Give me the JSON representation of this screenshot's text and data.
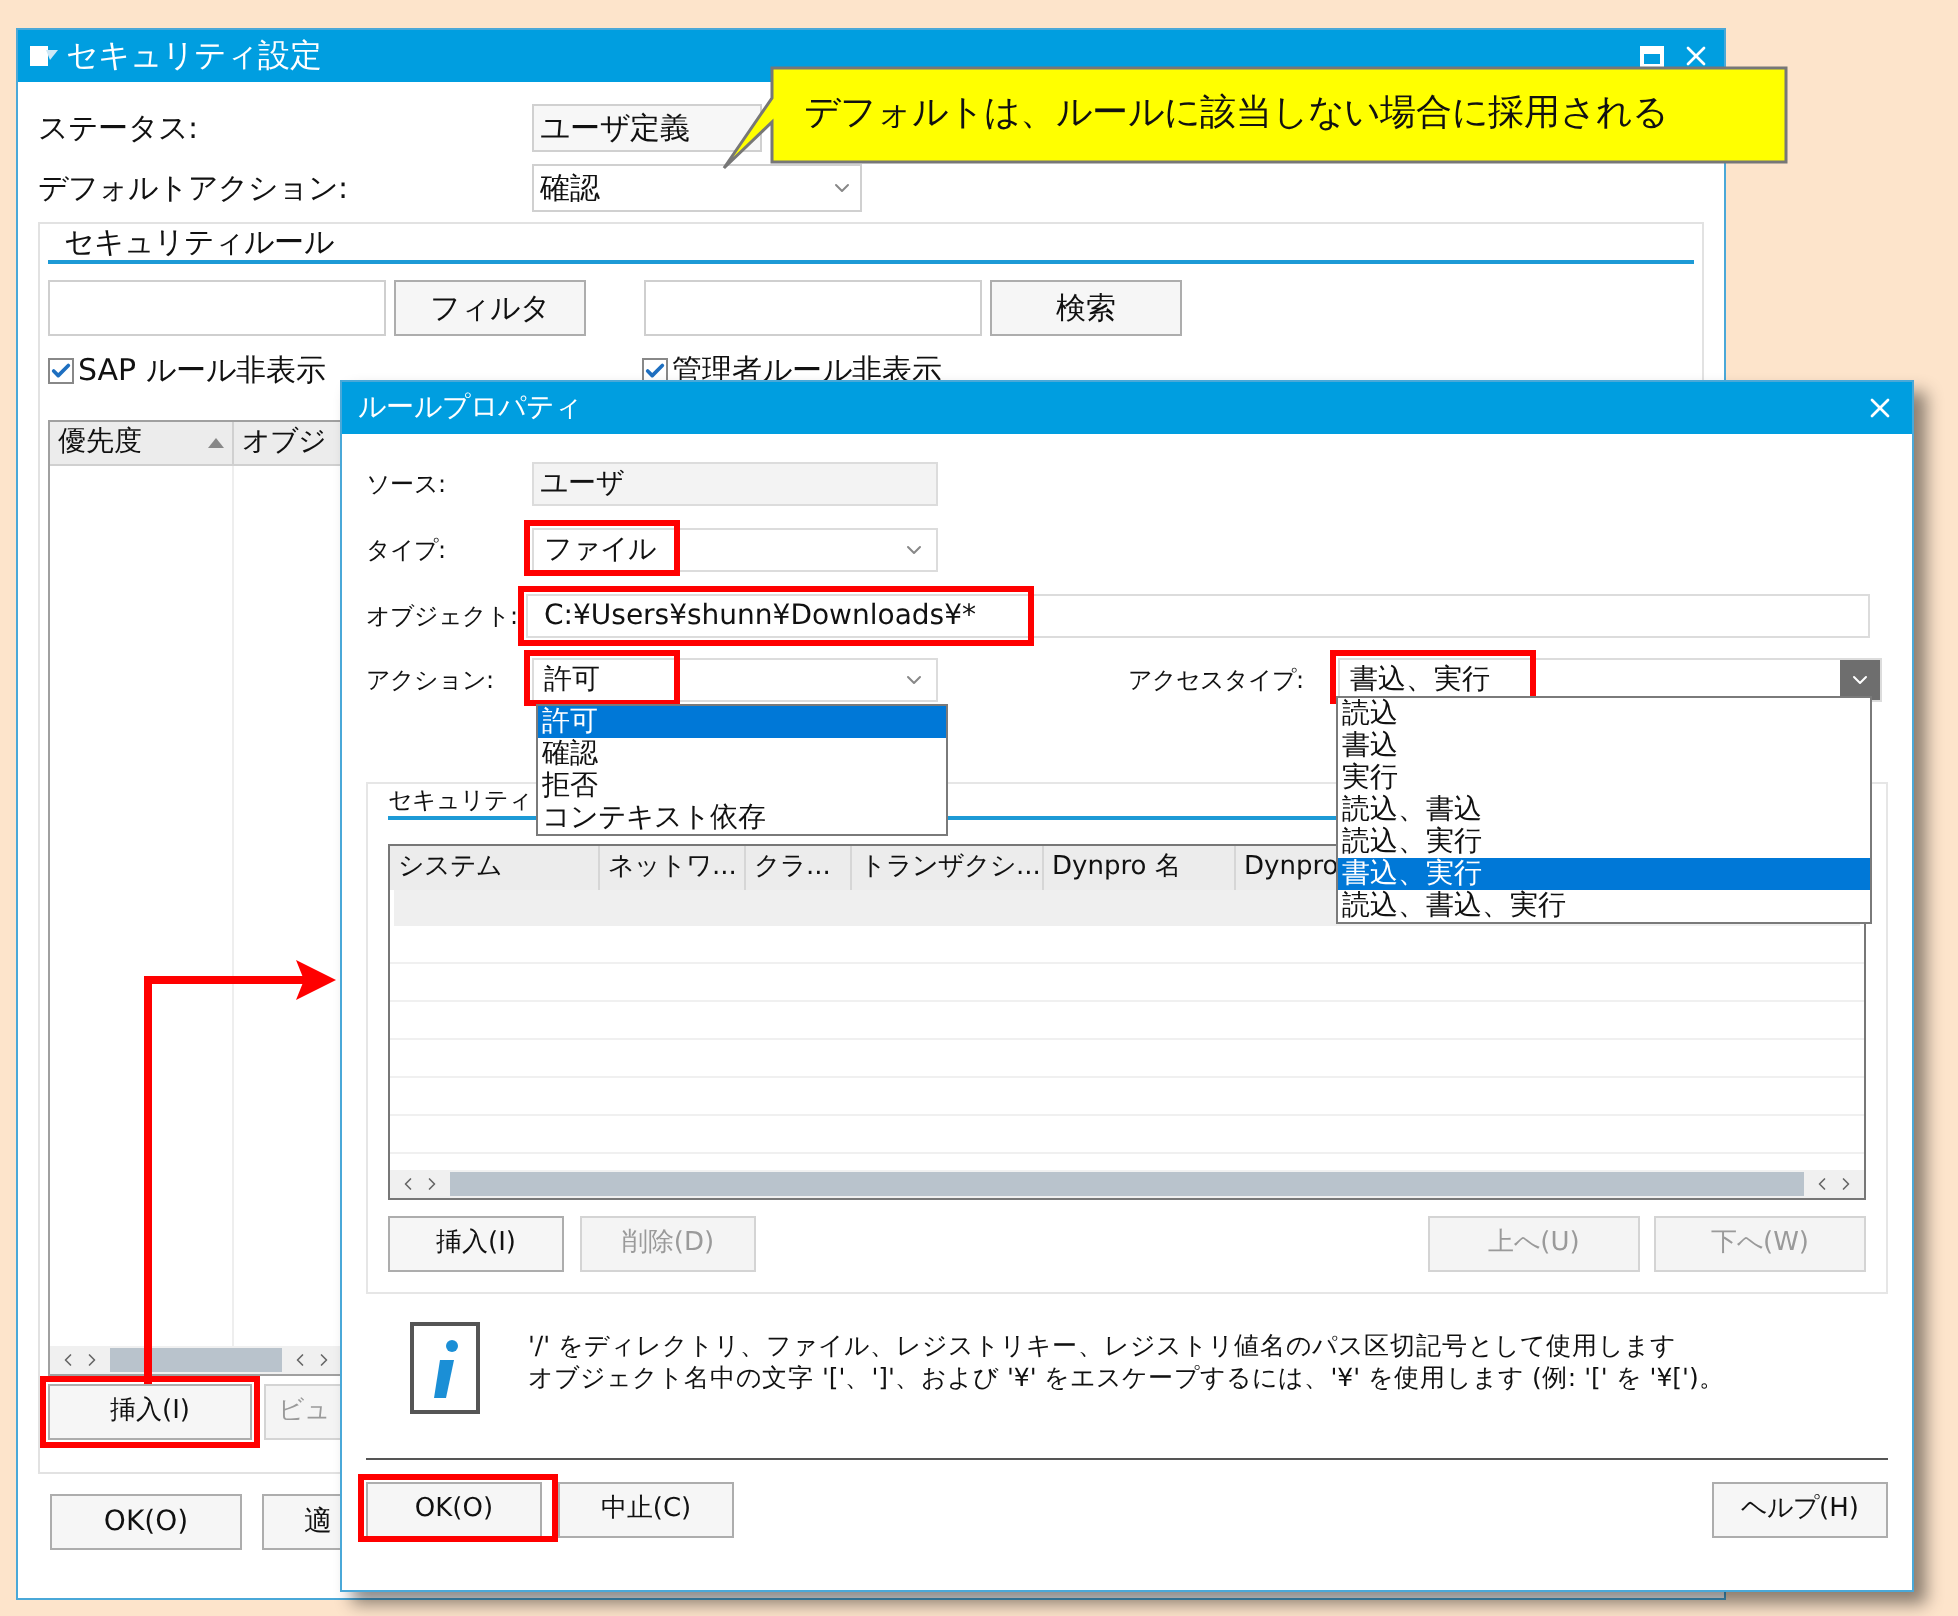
{
  "main_window": {
    "title": "セキュリティ設定",
    "fields": [
      {
        "label": "ステータス:",
        "value": "ユーザ定義",
        "kind": "text"
      },
      {
        "label": "デフォルトアクション:",
        "value": "確認",
        "kind": "dropdown"
      }
    ],
    "group_title": "セキュリティルール",
    "filter_button": "フィルタ",
    "search_button": "検索",
    "checkboxes": [
      {
        "label": "SAP ルール非表示",
        "checked": true
      },
      {
        "label": "管理者ルール非表示",
        "checked": true
      }
    ],
    "table_columns": [
      {
        "label": "優先度",
        "sorted": true
      },
      {
        "label": "オブジ",
        "sorted": false
      }
    ],
    "buttons": [
      {
        "label": "挿入(I)",
        "disabled": false,
        "highlighted": true
      },
      {
        "label": "ビュ",
        "disabled": true,
        "highlighted": false
      }
    ],
    "footer_buttons": [
      "OK(O)",
      "適"
    ]
  },
  "dialog": {
    "title": "ルールプロパティ",
    "source": {
      "label": "ソース:",
      "value": "ユーザ"
    },
    "type": {
      "label": "タイプ:",
      "value": "ファイル",
      "highlighted": true
    },
    "object": {
      "label": "オブジェクト:",
      "value": "C:¥Users¥shunn¥Downloads¥*",
      "highlighted": true
    },
    "action": {
      "label": "アクション:",
      "value": "許可",
      "highlighted": true,
      "options": [
        {
          "label": "許可",
          "selected": true
        },
        {
          "label": "確認",
          "selected": false
        },
        {
          "label": "拒否",
          "selected": false
        },
        {
          "label": "コンテキスト依存",
          "selected": false
        }
      ]
    },
    "access_type": {
      "label": "アクセスタイプ:",
      "value": "書込、実行",
      "highlighted": true,
      "options": [
        {
          "label": "読込",
          "selected": false
        },
        {
          "label": "書込",
          "selected": false
        },
        {
          "label": "実行",
          "selected": false
        },
        {
          "label": "読込、書込",
          "selected": false
        },
        {
          "label": "読込、実行",
          "selected": false
        },
        {
          "label": "書込、実行",
          "selected": true
        },
        {
          "label": "読込、書込、実行",
          "selected": false
        }
      ]
    },
    "group_title": "セキュリティ",
    "table_columns": [
      "システム",
      "ネットワ...",
      "クラ...",
      "トランザクシ...",
      "Dynpro 名",
      "Dynpro"
    ],
    "left_buttons": [
      {
        "label": "挿入(I)",
        "disabled": false
      },
      {
        "label": "削除(D)",
        "disabled": true
      }
    ],
    "right_buttons": [
      {
        "label": "上へ(U)",
        "disabled": true
      },
      {
        "label": "下へ(W)",
        "disabled": true
      }
    ],
    "info_lines": [
      "'/' をディレクトリ、ファイル、レジストリキー、レジストリ値名のパス区切記号として使用します",
      "オブジェクト名中の文字 '['、']'、および '¥' をエスケープするには、'¥' を使用します (例: '[' を '¥[')。"
    ],
    "footer_left": [
      {
        "label": "OK(O)",
        "highlighted": true
      },
      {
        "label": "中止(C)",
        "highlighted": false
      }
    ],
    "footer_right": [
      {
        "label": "ヘルプ(H)",
        "highlighted": false
      }
    ]
  },
  "callout": {
    "text": "デフォルトは、ルールに該当しない場合に採用される"
  }
}
